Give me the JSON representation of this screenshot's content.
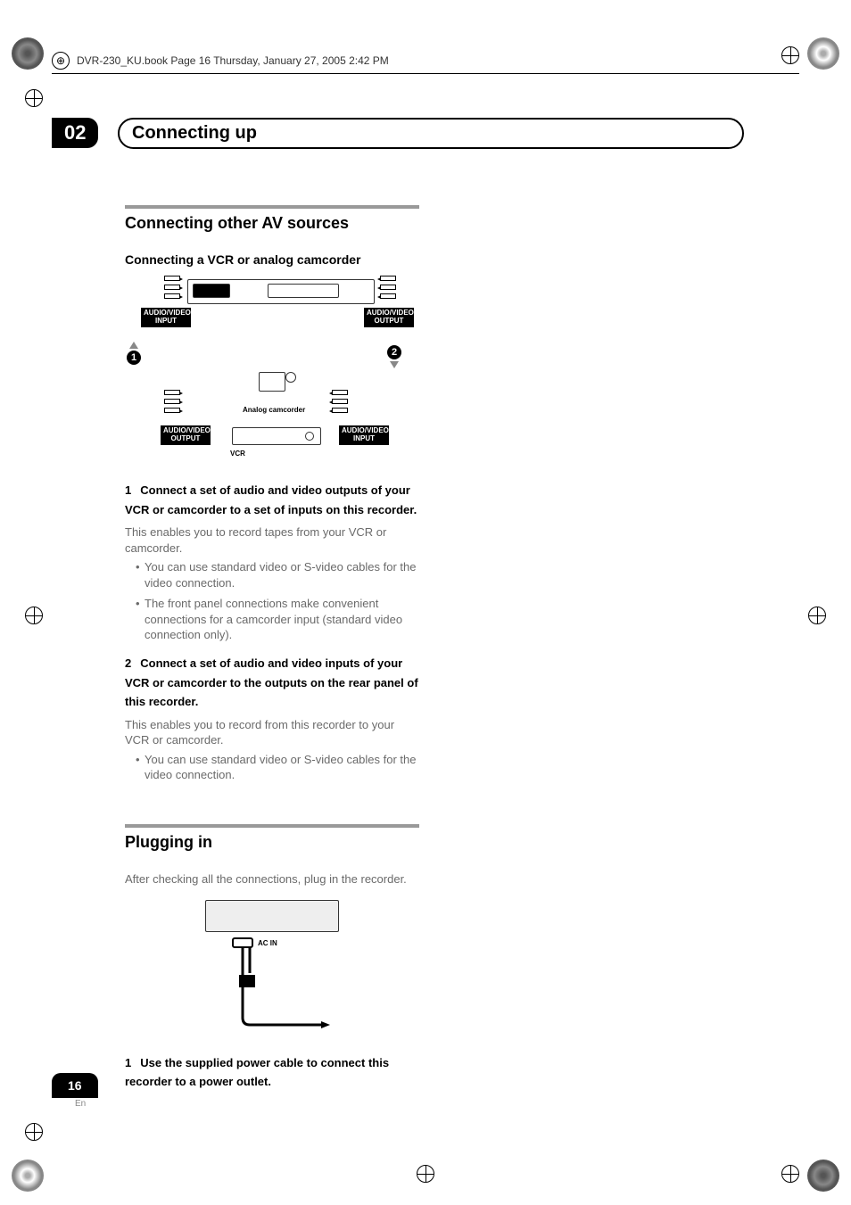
{
  "print_header": {
    "text": "DVR-230_KU.book  Page 16  Thursday, January 27, 2005  2:42 PM"
  },
  "chapter": {
    "number": "02",
    "title": "Connecting up"
  },
  "section1": {
    "heading": "Connecting other AV sources",
    "subheading": "Connecting a VCR or analog camcorder",
    "diagram": {
      "label_av_input": "AUDIO/VIDEO INPUT",
      "label_av_output": "AUDIO/VIDEO OUTPUT",
      "label_av_output2": "AUDIO/VIDEO OUTPUT",
      "label_av_input2": "AUDIO/VIDEO INPUT",
      "camcorder": "Analog camcorder",
      "vcr": "VCR",
      "num1": "1",
      "num2": "2"
    },
    "step1": {
      "num": "1",
      "title": "Connect a set of audio and video outputs of your VCR or camcorder to a set of inputs on this recorder.",
      "body": "This enables you to record tapes from your VCR or camcorder.",
      "bullets": [
        "You can use standard video or S-video cables for the video connection.",
        "The front panel connections make convenient connections for a camcorder input (standard video connection only)."
      ]
    },
    "step2": {
      "num": "2",
      "title": "Connect a set of audio and video inputs of your VCR or camcorder to the outputs on the rear panel of this recorder.",
      "body": "This enables you to record from this recorder to your VCR or camcorder.",
      "bullets": [
        "You can use standard video or S-video cables for the video connection."
      ]
    }
  },
  "section2": {
    "heading": "Plugging in",
    "body": "After checking all the connections, plug in the recorder.",
    "diagram": {
      "acin": "AC IN"
    },
    "step1": {
      "num": "1",
      "title": "Use the supplied power cable to connect this recorder to a power outlet."
    }
  },
  "page": {
    "number": "16",
    "lang": "En"
  }
}
